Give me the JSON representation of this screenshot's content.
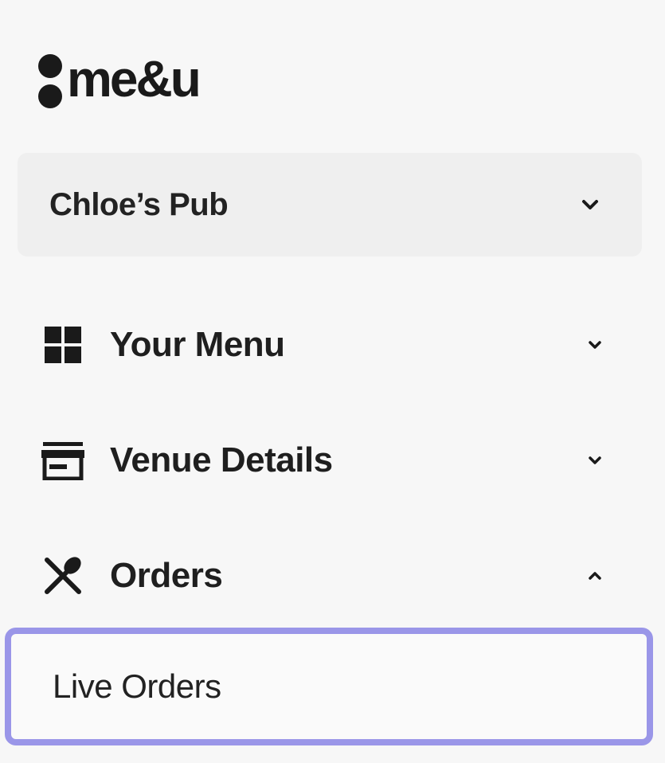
{
  "brand": {
    "logo_text": "me&u"
  },
  "venue": {
    "selected": "Chloe’s Pub"
  },
  "nav": {
    "items": [
      {
        "label": "Your Menu",
        "icon": "grid-icon",
        "expanded": false
      },
      {
        "label": "Venue Details",
        "icon": "storefront-icon",
        "expanded": false
      },
      {
        "label": "Orders",
        "icon": "utensils-icon",
        "expanded": true
      }
    ],
    "sub_items": [
      {
        "label": "Live Orders",
        "selected": true
      }
    ]
  },
  "colors": {
    "background": "#f7f7f7",
    "selector_bg": "#efefef",
    "highlight_border": "#9a96e8",
    "text": "#1f1f1f"
  }
}
